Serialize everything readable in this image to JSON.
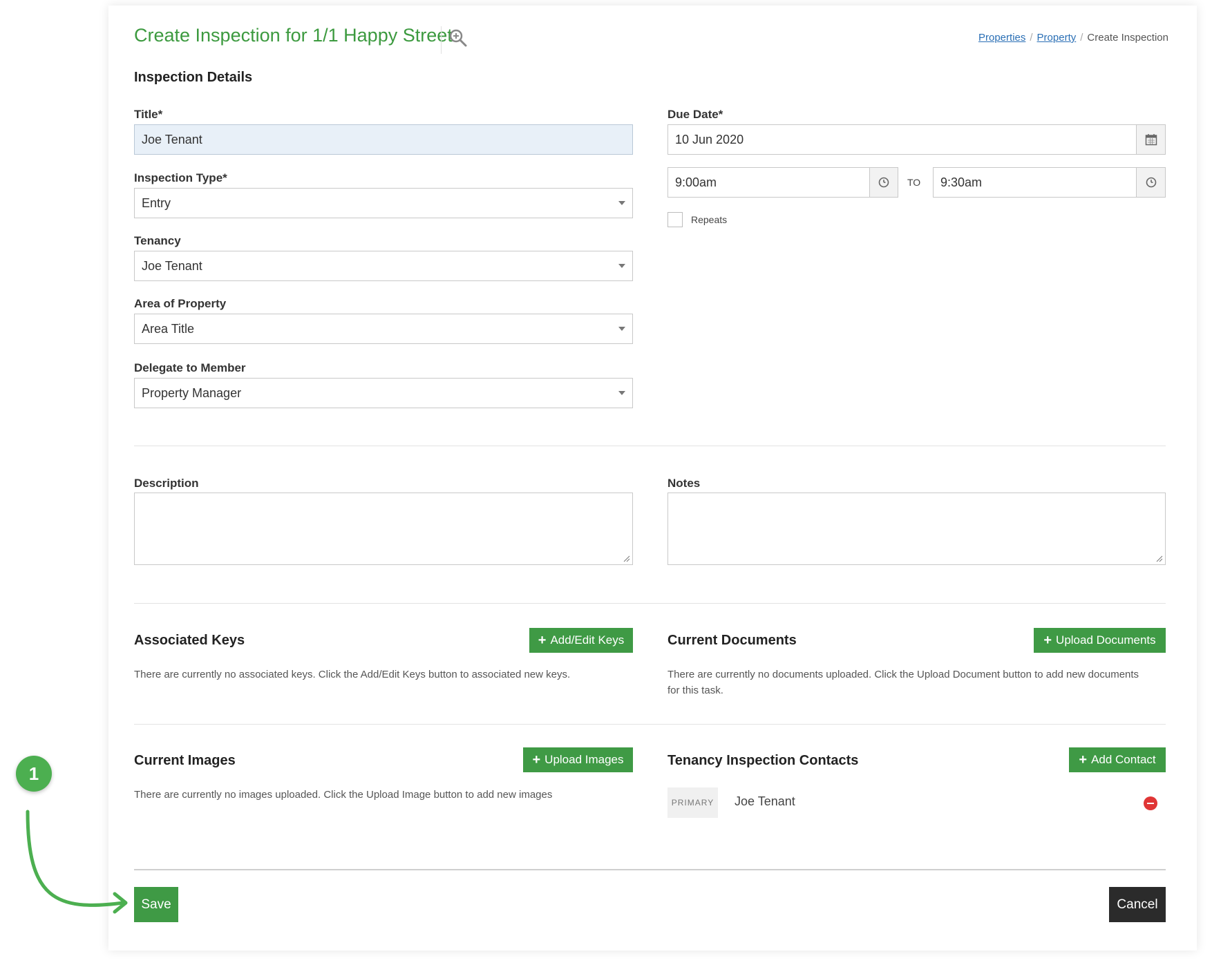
{
  "page": {
    "title": "Create Inspection for 1/1 Happy Street",
    "breadcrumb": {
      "items": [
        "Properties",
        "Property"
      ],
      "current": "Create Inspection",
      "separator": "/"
    }
  },
  "inspection_details": {
    "heading": "Inspection Details",
    "title": {
      "label": "Title*",
      "value": "Joe Tenant"
    },
    "inspection_type": {
      "label": "Inspection Type*",
      "value": "Entry"
    },
    "tenancy": {
      "label": "Tenancy",
      "value": "Joe Tenant"
    },
    "area": {
      "label": "Area of Property",
      "value": "Area Title"
    },
    "delegate": {
      "label": "Delegate to Member",
      "value": "Property Manager"
    },
    "due_date": {
      "label": "Due Date*",
      "value": "10 Jun 2020"
    },
    "start_time": "9:00am",
    "to_label": "TO",
    "end_time": "9:30am",
    "repeats_label": "Repeats"
  },
  "description": {
    "label": "Description",
    "value": ""
  },
  "notes": {
    "label": "Notes",
    "value": ""
  },
  "keys": {
    "heading": "Associated Keys",
    "button": "Add/Edit Keys",
    "empty_text": "There are currently no associated keys. Click the Add/Edit Keys button to associated new keys."
  },
  "documents": {
    "heading": "Current Documents",
    "button": "Upload Documents",
    "empty_text": "There are currently no documents uploaded. Click the Upload Document button to add new documents for this task."
  },
  "images": {
    "heading": "Current Images",
    "button": "Upload Images",
    "empty_text": "There are currently no images uploaded. Click the Upload Image button to add new images"
  },
  "contacts": {
    "heading": "Tenancy Inspection Contacts",
    "button": "Add Contact",
    "items": [
      {
        "badge": "PRIMARY",
        "name": "Joe Tenant"
      }
    ]
  },
  "actions": {
    "save": "Save",
    "cancel": "Cancel"
  },
  "annotation": {
    "step_number": "1"
  },
  "colors": {
    "accent_green": "#3f9a45",
    "title_green": "#3c9a3f",
    "link_blue": "#2a6fb5",
    "cancel_dark": "#2b2b2b",
    "remove_red": "#e03535"
  },
  "icons": [
    "zoom-in-icon",
    "calendar-icon",
    "clock-icon",
    "plus-icon",
    "remove-icon",
    "arrow-icon"
  ]
}
